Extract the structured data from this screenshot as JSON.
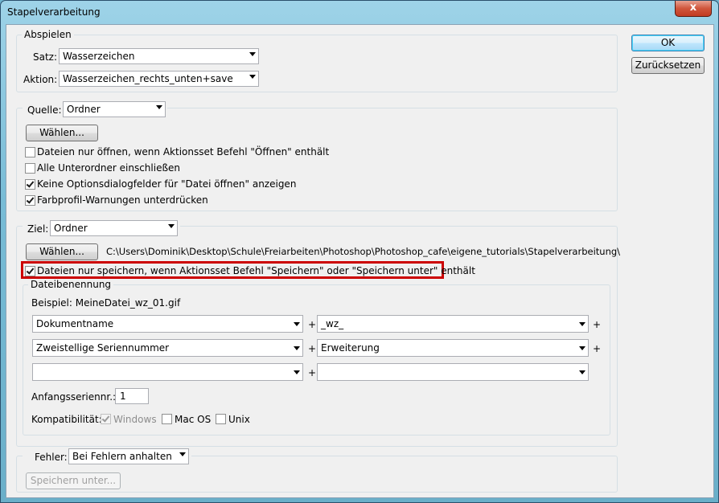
{
  "window": {
    "title": "Stapelverarbeitung",
    "close_label": "x"
  },
  "actions": {
    "ok_label": "OK",
    "reset_label": "Zurücksetzen"
  },
  "play": {
    "legend": "Abspielen",
    "set_label": "Satz:",
    "set_value": "Wasserzeichen",
    "action_label": "Aktion:",
    "action_value": "Wasserzeichen_rechts_unten+save"
  },
  "source": {
    "label": "Quelle:",
    "value": "Ordner",
    "choose_label": "Wählen...",
    "options": [
      {
        "label": "Dateien nur öffnen, wenn Aktionsset Befehl \"Öffnen\" enthält",
        "checked": false
      },
      {
        "label": "Alle Unterordner einschließen",
        "checked": false
      },
      {
        "label": "Keine Optionsdialogfelder für \"Datei öffnen\" anzeigen",
        "checked": true
      },
      {
        "label": "Farbprofil-Warnungen unterdrücken",
        "checked": true
      }
    ]
  },
  "target": {
    "label": "Ziel:",
    "value": "Ordner",
    "choose_label": "Wählen...",
    "path": "C:\\Users\\Dominik\\Desktop\\Schule\\Freiarbeiten\\Photoshop\\Photoshop_cafe\\eigene_tutorials\\Stapelverarbeitung\\",
    "save_only_label": "Dateien nur speichern, wenn Aktionsset Befehl \"Speichern\" oder \"Speichern unter\" enthält",
    "save_only_checked": true,
    "highlight_color": "#cc0000"
  },
  "naming": {
    "legend": "Dateibenennung",
    "example": "Beispiel: MeineDatei_wz_01.gif",
    "plus": "+",
    "rows": [
      {
        "left": "Dokumentname",
        "right": "_wz_"
      },
      {
        "left": "Zweistellige Seriennummer",
        "right": "Erweiterung"
      },
      {
        "left": "",
        "right": ""
      }
    ],
    "start_label": "Anfangsseriennr.:",
    "start_value": "1",
    "compat_label": "Kompatibilität:",
    "compat": [
      {
        "label": "Windows",
        "checked": true,
        "disabled": true
      },
      {
        "label": "Mac OS",
        "checked": false,
        "disabled": false
      },
      {
        "label": "Unix",
        "checked": false,
        "disabled": false
      }
    ]
  },
  "errors": {
    "label": "Fehler:",
    "value": "Bei Fehlern anhalten",
    "save_as_label": "Speichern unter..."
  }
}
